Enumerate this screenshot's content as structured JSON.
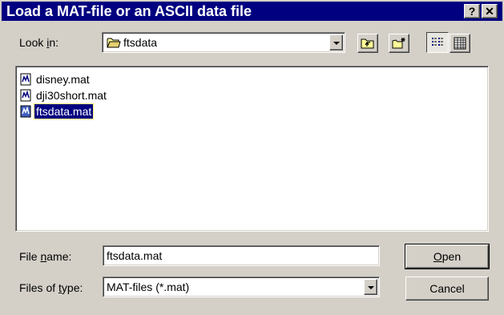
{
  "window": {
    "title": "Load a MAT-file or an ASCII data file",
    "help_label": "?",
    "close_label": "✕"
  },
  "lookin": {
    "label_pre": "Look ",
    "label_ul": "i",
    "label_post": "n:",
    "value": "ftsdata"
  },
  "toolbar": {
    "icons": [
      "up-one-level-icon",
      "create-new-folder-icon",
      "list-view-icon",
      "details-view-icon"
    ]
  },
  "files": [
    {
      "name": "disney.mat",
      "selected": false
    },
    {
      "name": "dji30short.mat",
      "selected": false
    },
    {
      "name": "ftsdata.mat",
      "selected": true
    }
  ],
  "filename": {
    "label_pre": "File ",
    "label_ul": "n",
    "label_post": "ame:",
    "value": "ftsdata.mat"
  },
  "filetype": {
    "label_pre": "Files of ",
    "label_ul": "t",
    "label_post": "ype:",
    "value": "MAT-files (*.mat)"
  },
  "buttons": {
    "open_ul": "O",
    "open_rest": "pen",
    "cancel": "Cancel"
  }
}
